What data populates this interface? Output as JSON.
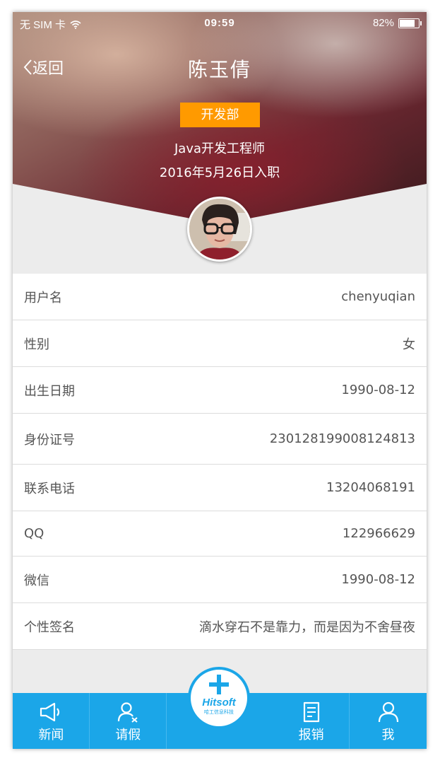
{
  "status_bar": {
    "carrier": "无 SIM 卡",
    "time": "09:59",
    "battery": "82%",
    "battery_level": 0.82
  },
  "header": {
    "back_label": "返回",
    "title": "陈玉倩",
    "department": "开发部",
    "job_title": "Java开发工程师",
    "hire_date": "2016年5月26日入职"
  },
  "profile": {
    "rows": [
      {
        "label": "用户名",
        "value": "chenyuqian"
      },
      {
        "label": "性别",
        "value": "女"
      },
      {
        "label": "出生日期",
        "value": "1990-08-12"
      },
      {
        "label": "身份证号",
        "value": "230128199008124813"
      },
      {
        "label": "联系电话",
        "value": "13204068191"
      },
      {
        "label": "QQ",
        "value": "122966629"
      },
      {
        "label": "微信",
        "value": "1990-08-12"
      },
      {
        "label": "个性签名",
        "value": "滴水穿石不是靠力，而是因为不舍昼夜"
      }
    ]
  },
  "tabbar": {
    "items": [
      {
        "label": "新闻",
        "icon": "megaphone-icon"
      },
      {
        "label": "请假",
        "icon": "user-leave-icon"
      },
      {
        "label": "报销",
        "icon": "document-icon"
      },
      {
        "label": "我",
        "icon": "user-icon"
      }
    ],
    "center": {
      "icon": "plus-icon",
      "brand": "Hitsoft",
      "brand_sub": "哈工信息科技"
    }
  },
  "colors": {
    "accent": "#1ba6e8",
    "badge": "#ff9a00",
    "background": "#ececec"
  }
}
